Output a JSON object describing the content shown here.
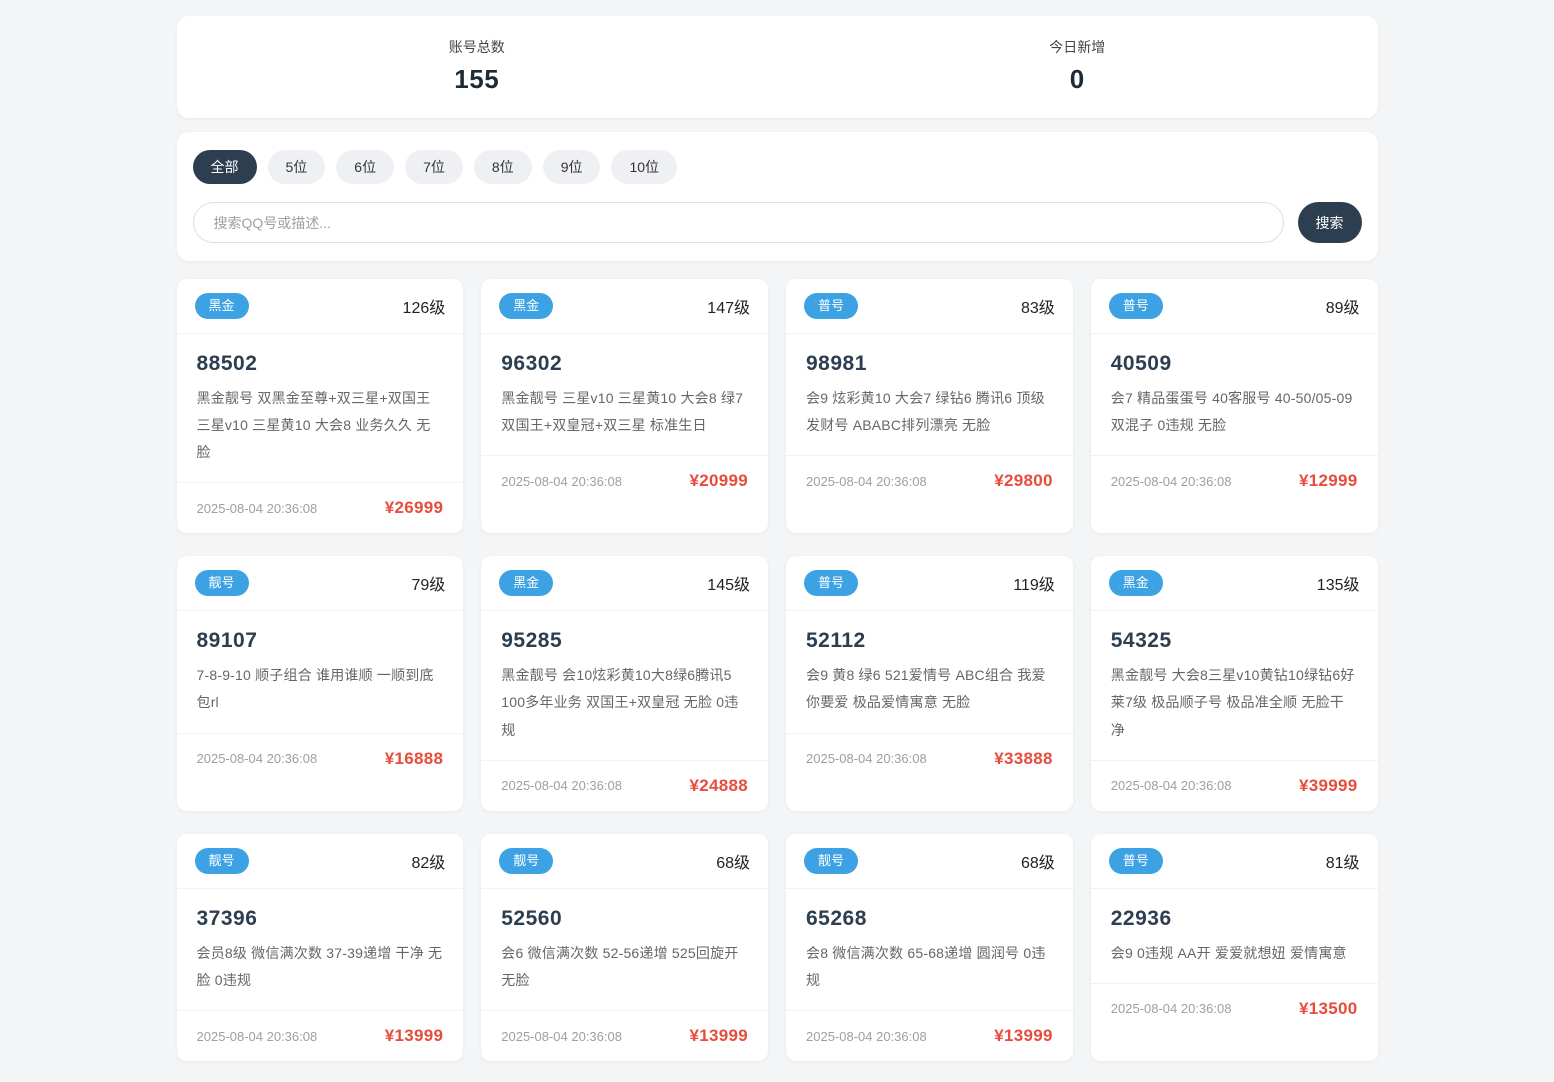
{
  "colors": {
    "accent-blue": "#3da2e4",
    "dark-navy": "#2c3e50",
    "price-red": "#e74c3c",
    "page-bg": "#f3f5f7"
  },
  "stats": {
    "total_label": "账号总数",
    "total_value": "155",
    "today_label": "今日新增",
    "today_value": "0"
  },
  "filters": {
    "tabs": [
      {
        "id": "all",
        "label": "全部",
        "active": true
      },
      {
        "id": "5digit",
        "label": "5位",
        "active": false
      },
      {
        "id": "6digit",
        "label": "6位",
        "active": false
      },
      {
        "id": "7digit",
        "label": "7位",
        "active": false
      },
      {
        "id": "8digit",
        "label": "8位",
        "active": false
      },
      {
        "id": "9digit",
        "label": "9位",
        "active": false
      },
      {
        "id": "10digit",
        "label": "10位",
        "active": false
      }
    ],
    "search_placeholder": "搜索QQ号或描述...",
    "search_button": "搜索"
  },
  "cards": [
    {
      "badge": "黑金",
      "level": "126级",
      "qq": "88502",
      "description": "黑金靓号 双黑金至尊+双三星+双国王 三星v10 三星黄10 大会8 业务久久 无脸",
      "date": "2025-08-04 20:36:08",
      "price": "¥26999"
    },
    {
      "badge": "黑金",
      "level": "147级",
      "qq": "96302",
      "description": "黑金靓号 三星v10 三星黄10 大会8 绿7 双国王+双皇冠+双三星 标准生日",
      "date": "2025-08-04 20:36:08",
      "price": "¥20999"
    },
    {
      "badge": "普号",
      "level": "83级",
      "qq": "98981",
      "description": "会9 炫彩黄10 大会7 绿钻6 腾讯6 顶级发财号 ABABC排列漂亮 无脸",
      "date": "2025-08-04 20:36:08",
      "price": "¥29800"
    },
    {
      "badge": "普号",
      "level": "89级",
      "qq": "40509",
      "description": "会7 精品蛋蛋号 40客服号 40-50/05-09 双混子 0违规 无脸",
      "date": "2025-08-04 20:36:08",
      "price": "¥12999"
    },
    {
      "badge": "靓号",
      "level": "79级",
      "qq": "89107",
      "description": "7-8-9-10 顺子组合 谁用谁顺 一顺到底 包rl",
      "date": "2025-08-04 20:36:08",
      "price": "¥16888"
    },
    {
      "badge": "黑金",
      "level": "145级",
      "qq": "95285",
      "description": "黑金靓号 会10炫彩黄10大8绿6腾讯5 100多年业务 双国王+双皇冠 无脸 0违规",
      "date": "2025-08-04 20:36:08",
      "price": "¥24888"
    },
    {
      "badge": "普号",
      "level": "119级",
      "qq": "52112",
      "description": "会9 黄8 绿6 521爱情号 ABC组合 我爱你要爱 极品爱情寓意 无脸",
      "date": "2025-08-04 20:36:08",
      "price": "¥33888"
    },
    {
      "badge": "黑金",
      "level": "135级",
      "qq": "54325",
      "description": "黑金靓号 大会8三星v10黄钻10绿钻6好莱7级 极品顺子号 极品准全顺 无脸干净",
      "date": "2025-08-04 20:36:08",
      "price": "¥39999"
    },
    {
      "badge": "靓号",
      "level": "82级",
      "qq": "37396",
      "description": "会员8级 微信满次数 37-39递增 干净 无脸 0违规",
      "date": "2025-08-04 20:36:08",
      "price": "¥13999"
    },
    {
      "badge": "靓号",
      "level": "68级",
      "qq": "52560",
      "description": "会6 微信满次数 52-56递增 525回旋开 无脸",
      "date": "2025-08-04 20:36:08",
      "price": "¥13999"
    },
    {
      "badge": "靓号",
      "level": "68级",
      "qq": "65268",
      "description": "会8 微信满次数 65-68递增 圆润号 0违规",
      "date": "2025-08-04 20:36:08",
      "price": "¥13999"
    },
    {
      "badge": "普号",
      "level": "81级",
      "qq": "22936",
      "description": "会9 0违规 AA开 爱爱就想妞 爱情寓意",
      "date": "2025-08-04 20:36:08",
      "price": "¥13500"
    }
  ]
}
